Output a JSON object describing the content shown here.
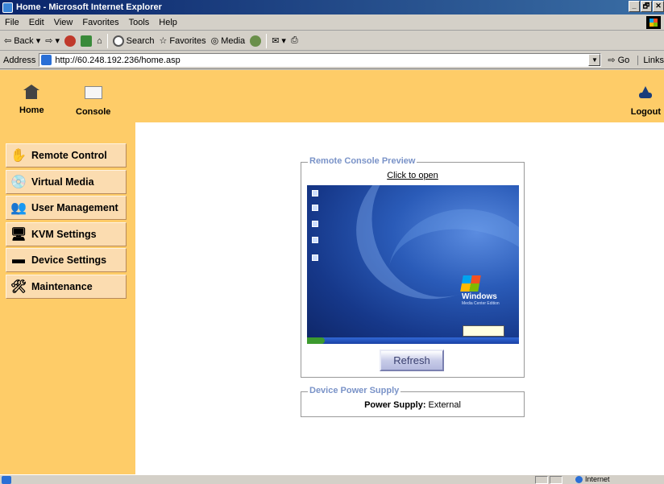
{
  "browser": {
    "title": "Home - Microsoft Internet Explorer",
    "window_controls": [
      "_",
      "🗗",
      "✕"
    ],
    "menu": [
      "File",
      "Edit",
      "View",
      "Favorites",
      "Tools",
      "Help"
    ],
    "toolbar": {
      "back": "Back",
      "search": "Search",
      "favorites": "Favorites",
      "media": "Media"
    },
    "address_label": "Address",
    "url": "http://60.248.192.236/home.asp",
    "go_label": "Go",
    "links_label": "Links",
    "status_zone": "Internet"
  },
  "header": {
    "home_label": "Home",
    "console_label": "Console",
    "logout_label": "Logout"
  },
  "sidebar": {
    "items": [
      {
        "label": "Remote Control",
        "icon": "hand-icon"
      },
      {
        "label": "Virtual Media",
        "icon": "disc-icon"
      },
      {
        "label": "User Management",
        "icon": "users-icon"
      },
      {
        "label": "KVM Settings",
        "icon": "computer-icon"
      },
      {
        "label": "Device Settings",
        "icon": "device-icon"
      },
      {
        "label": "Maintenance",
        "icon": "tools-icon"
      }
    ]
  },
  "preview": {
    "legend": "Remote Console Preview",
    "link": "Click to open",
    "desktop_brand": "Windows",
    "desktop_sub": "Media Center Edition",
    "refresh_label": "Refresh"
  },
  "power": {
    "legend": "Device Power Supply",
    "label": "Power Supply:",
    "value": "External"
  },
  "colors": {
    "panel": "#fecc68",
    "menu_button": "#fbdcb0",
    "legend_text": "#7a93c8"
  }
}
